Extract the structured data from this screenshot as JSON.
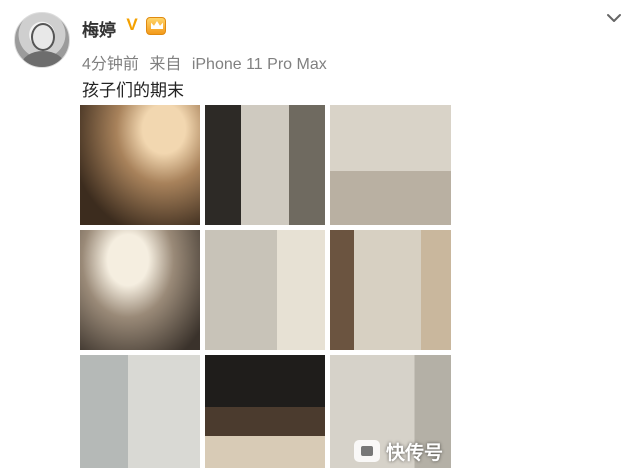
{
  "post": {
    "username": "梅婷",
    "verified_badge": "V",
    "time_ago": "4分钟前",
    "source_prefix": "来自",
    "source_device": "iPhone 11 Pro Max",
    "text": "孩子们的期末"
  },
  "icons": {
    "avatar": "avatar",
    "vip": "crown-icon",
    "more": "chevron-down-icon"
  },
  "photos": [
    {
      "label": "photo-1"
    },
    {
      "label": "photo-2"
    },
    {
      "label": "photo-3"
    },
    {
      "label": "photo-4"
    },
    {
      "label": "photo-5"
    },
    {
      "label": "photo-6"
    },
    {
      "label": "photo-7"
    },
    {
      "label": "photo-8"
    },
    {
      "label": "photo-9"
    }
  ],
  "watermark": {
    "text": "快传号"
  },
  "colors": {
    "accent": "#f4a100",
    "meta_text": "#808080"
  }
}
